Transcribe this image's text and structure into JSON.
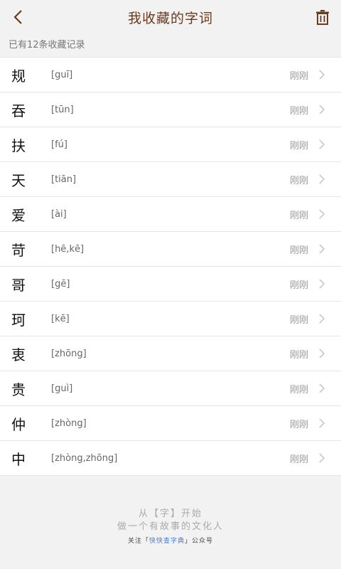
{
  "header": {
    "title": "我收藏的字词",
    "back_icon": "back-arrow-icon",
    "delete_icon": "trash-icon"
  },
  "summary": "已有12条收藏记录",
  "items": [
    {
      "char": "规",
      "pinyin": "[guī]",
      "time": "刚刚"
    },
    {
      "char": "吞",
      "pinyin": "[tūn]",
      "time": "刚刚"
    },
    {
      "char": "扶",
      "pinyin": "[fú]",
      "time": "刚刚"
    },
    {
      "char": "天",
      "pinyin": "[tiān]",
      "time": "刚刚"
    },
    {
      "char": "爱",
      "pinyin": "[ài]",
      "time": "刚刚"
    },
    {
      "char": "苛",
      "pinyin": "[hē,kē]",
      "time": "刚刚"
    },
    {
      "char": "哥",
      "pinyin": "[gē]",
      "time": "刚刚"
    },
    {
      "char": "珂",
      "pinyin": "[kē]",
      "time": "刚刚"
    },
    {
      "char": "衷",
      "pinyin": "[zhōng]",
      "time": "刚刚"
    },
    {
      "char": "贵",
      "pinyin": "[guì]",
      "time": "刚刚"
    },
    {
      "char": "仲",
      "pinyin": "[zhòng]",
      "time": "刚刚"
    },
    {
      "char": "中",
      "pinyin": "[zhòng,zhōng]",
      "time": "刚刚"
    }
  ],
  "footer": {
    "line1": "从【字】开始",
    "line2": "做一个有故事的文化人",
    "line3_prefix": "关注「",
    "line3_highlight": "快快查字典",
    "line3_suffix": "」公众号"
  },
  "colors": {
    "accent": "#6b3a1e",
    "highlight": "#4a7bd0"
  }
}
